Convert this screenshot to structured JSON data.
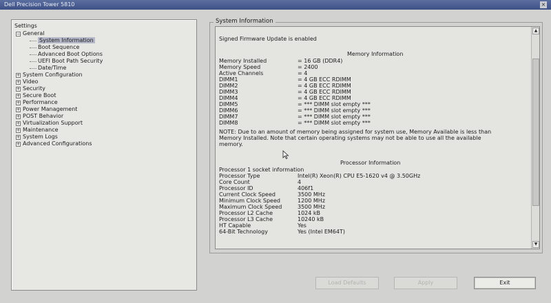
{
  "window": {
    "title": "Dell Precision Tower 5810"
  },
  "sidebar": {
    "root": "Settings",
    "items": [
      {
        "label": "General",
        "expander": "−",
        "level": 1
      },
      {
        "label": "System Information",
        "level": 2,
        "selected": true
      },
      {
        "label": "Boot Sequence",
        "level": 2
      },
      {
        "label": "Advanced Boot Options",
        "level": 2
      },
      {
        "label": "UEFI Boot Path Security",
        "level": 2
      },
      {
        "label": "Date/Time",
        "level": 2
      },
      {
        "label": "System Configuration",
        "expander": "+",
        "level": 1
      },
      {
        "label": "Video",
        "expander": "+",
        "level": 1
      },
      {
        "label": "Security",
        "expander": "+",
        "level": 1
      },
      {
        "label": "Secure Boot",
        "expander": "+",
        "level": 1
      },
      {
        "label": "Performance",
        "expander": "+",
        "level": 1
      },
      {
        "label": "Power Management",
        "expander": "+",
        "level": 1
      },
      {
        "label": "POST Behavior",
        "expander": "+",
        "level": 1
      },
      {
        "label": "Virtualization Support",
        "expander": "+",
        "level": 1
      },
      {
        "label": "Maintenance",
        "expander": "+",
        "level": 1
      },
      {
        "label": "System Logs",
        "expander": "+",
        "level": 1
      },
      {
        "label": "Advanced Configurations",
        "expander": "+",
        "level": 1
      }
    ]
  },
  "main": {
    "group_title": "System Information",
    "firmware_line": "Signed Firmware Update is enabled",
    "memory": {
      "header": "Memory Information",
      "rows": [
        {
          "label": "Memory Installed",
          "value": "= 16 GB (DDR4)"
        },
        {
          "label": "Memory Speed",
          "value": "= 2400"
        },
        {
          "label": "Active Channels",
          "value": "= 4"
        },
        {
          "label": "DIMM1",
          "value": "= 4 GB ECC RDIMM"
        },
        {
          "label": "DIMM2",
          "value": "= 4 GB ECC RDIMM"
        },
        {
          "label": "DIMM3",
          "value": "= 4 GB ECC RDIMM"
        },
        {
          "label": "DIMM4",
          "value": "= 4 GB ECC RDIMM"
        },
        {
          "label": "DIMM5",
          "value": "= *** DIMM slot empty ***"
        },
        {
          "label": "DIMM6",
          "value": "= *** DIMM slot empty ***"
        },
        {
          "label": "DIMM7",
          "value": "= *** DIMM slot empty ***"
        },
        {
          "label": "DIMM8",
          "value": "= *** DIMM slot empty ***"
        }
      ],
      "note": "NOTE: Due to an amount of memory being assigned for system use, Memory Available is less than Memory Installed. Note that certain operating systems may not be able to use all the available memory."
    },
    "processor": {
      "header": "Processor Information",
      "rows": [
        {
          "label": "Processor 1 socket information",
          "value": ""
        },
        {
          "label": "Processor Type",
          "value": "Intel(R) Xeon(R) CPU E5-1620 v4 @ 3.50GHz"
        },
        {
          "label": "Core Count",
          "value": "4"
        },
        {
          "label": "Processor ID",
          "value": "406f1"
        },
        {
          "label": "Current Clock Speed",
          "value": "3500 MHz"
        },
        {
          "label": "Minimum Clock Speed",
          "value": "1200 MHz"
        },
        {
          "label": "Maximum Clock Speed",
          "value": "3500 MHz"
        },
        {
          "label": "Processor L2 Cache",
          "value": "1024 kB"
        },
        {
          "label": "Processor L3 Cache",
          "value": "10240 kB"
        },
        {
          "label": "HT Capable",
          "value": "Yes"
        },
        {
          "label": "64-Bit Technology",
          "value": "Yes (Intel EM64T)"
        }
      ]
    }
  },
  "buttons": {
    "load_defaults": "Load Defaults",
    "apply": "Apply",
    "exit": "Exit"
  },
  "icons": {
    "scroll_up": "▲",
    "scroll_down": "▼",
    "close": "×"
  }
}
